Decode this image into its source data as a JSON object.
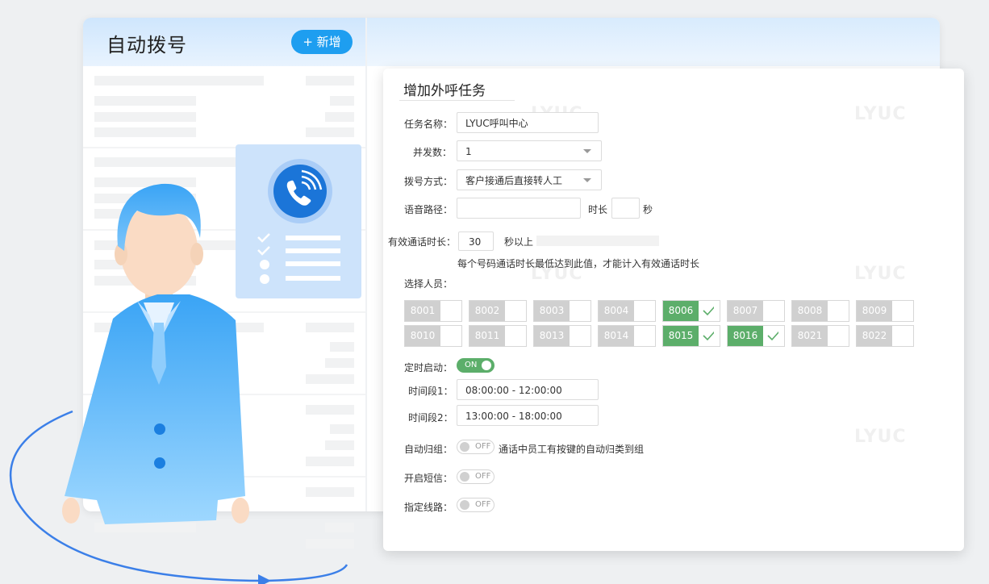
{
  "app": {
    "title": "自动拨号",
    "add_button": "+ 新增"
  },
  "form": {
    "title": "增加外呼任务",
    "task_name": {
      "label": "任务名称：",
      "value": "LYUC呼叫中心"
    },
    "concurrency": {
      "label": "并发数：",
      "value": "1"
    },
    "dial_mode": {
      "label": "拨号方式：",
      "value": "客户接通后直接转人工"
    },
    "voice_path": {
      "label": "语音路径：",
      "value": "",
      "duration_label": "时长",
      "duration_value": "",
      "unit": "秒"
    },
    "valid_duration": {
      "label": "有效通话时长：",
      "value": "30",
      "suffix": "秒以上",
      "hint": "每个号码通话时长最低达到此值，才能计入有效通话时长"
    },
    "staff": {
      "label": "选择人员：",
      "extensions": [
        {
          "num": "8001",
          "selected": false
        },
        {
          "num": "8002",
          "selected": false
        },
        {
          "num": "8003",
          "selected": false
        },
        {
          "num": "8004",
          "selected": false
        },
        {
          "num": "8006",
          "selected": true
        },
        {
          "num": "8007",
          "selected": false
        },
        {
          "num": "8008",
          "selected": false
        },
        {
          "num": "8009",
          "selected": false
        },
        {
          "num": "8010",
          "selected": false
        },
        {
          "num": "8011",
          "selected": false
        },
        {
          "num": "8013",
          "selected": false
        },
        {
          "num": "8014",
          "selected": false
        },
        {
          "num": "8015",
          "selected": true
        },
        {
          "num": "8016",
          "selected": true
        },
        {
          "num": "8021",
          "selected": false
        },
        {
          "num": "8022",
          "selected": false
        }
      ]
    },
    "schedule": {
      "label": "定时启动：",
      "state": "ON"
    },
    "period1": {
      "label": "时间段1：",
      "value": "08:00:00 - 12:00:00"
    },
    "period2": {
      "label": "时间段2：",
      "value": "13:00:00 - 18:00:00"
    },
    "auto_group": {
      "label": "自动归组：",
      "state": "OFF",
      "hint": "通话中员工有按键的自动归类到组"
    },
    "sms": {
      "label": "开启短信：",
      "state": "OFF"
    },
    "line": {
      "label": "指定线路：",
      "state": "OFF"
    }
  },
  "watermark": "LYUC",
  "colors": {
    "accent": "#1e9ef0",
    "selected": "#5cae6a",
    "unselected": "#d0d0d0"
  }
}
